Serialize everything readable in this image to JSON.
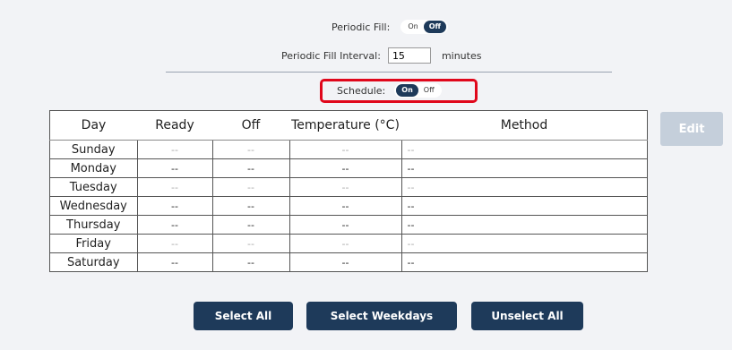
{
  "periodic_fill": {
    "label": "Periodic Fill:",
    "on": "On",
    "off": "Off",
    "active": "Off"
  },
  "interval": {
    "label": "Periodic Fill Interval:",
    "value": "15",
    "unit": "minutes"
  },
  "schedule": {
    "label": "Schedule:",
    "on": "On",
    "off": "Off",
    "active": "On"
  },
  "table": {
    "headers": [
      "Day",
      "Ready",
      "Off",
      "Temperature (°C)",
      "Method"
    ],
    "rows": [
      {
        "day": "Sunday",
        "ready": "--",
        "off": "--",
        "temp": "--",
        "method": "--"
      },
      {
        "day": "Monday",
        "ready": "--",
        "off": "--",
        "temp": "--",
        "method": "--"
      },
      {
        "day": "Tuesday",
        "ready": "--",
        "off": "--",
        "temp": "--",
        "method": "--"
      },
      {
        "day": "Wednesday",
        "ready": "--",
        "off": "--",
        "temp": "--",
        "method": "--"
      },
      {
        "day": "Thursday",
        "ready": "--",
        "off": "--",
        "temp": "--",
        "method": "--"
      },
      {
        "day": "Friday",
        "ready": "--",
        "off": "--",
        "temp": "--",
        "method": "--"
      },
      {
        "day": "Saturday",
        "ready": "--",
        "off": "--",
        "temp": "--",
        "method": "--"
      }
    ]
  },
  "buttons": {
    "edit": "Edit",
    "select_all": "Select All",
    "select_weekdays": "Select Weekdays",
    "unselect_all": "Unselect All"
  },
  "colors": {
    "accent": "#1e3a5a",
    "highlight": "#e0071b",
    "disabled": "#c5cfdb"
  }
}
